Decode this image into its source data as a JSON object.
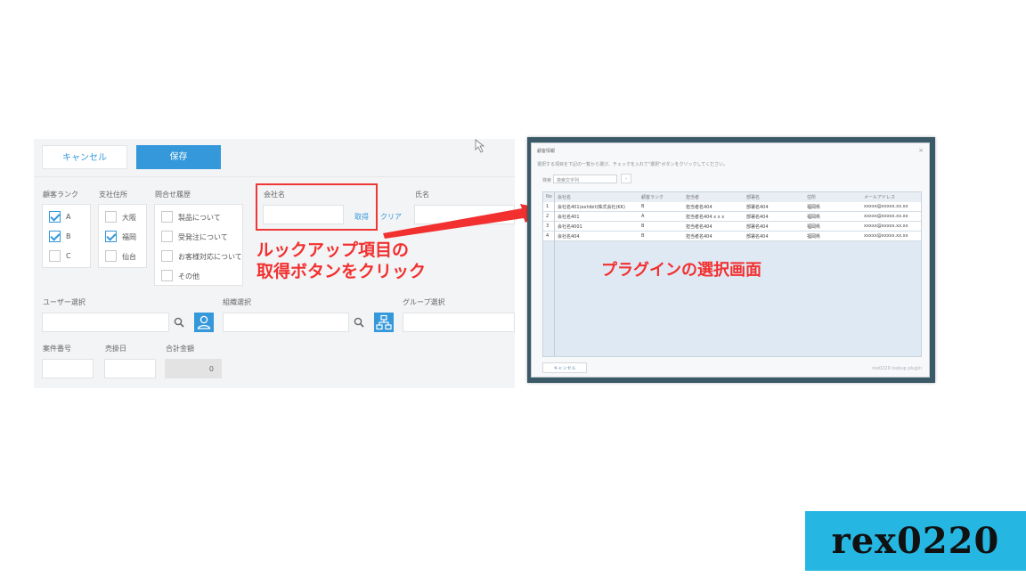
{
  "form": {
    "cancel_label": "キャンセル",
    "save_label": "保存",
    "rank": {
      "label": "顧客ランク",
      "options": [
        {
          "label": "A",
          "checked": true
        },
        {
          "label": "B",
          "checked": true
        },
        {
          "label": "C",
          "checked": false
        }
      ]
    },
    "branch": {
      "label": "支社住所",
      "options": [
        {
          "label": "大阪",
          "checked": false
        },
        {
          "label": "福岡",
          "checked": true
        },
        {
          "label": "仙台",
          "checked": false
        }
      ]
    },
    "inquiry": {
      "label": "問合せ履歴",
      "options": [
        {
          "label": "製品について",
          "checked": false
        },
        {
          "label": "受発注について",
          "checked": false
        },
        {
          "label": "お客様対応について",
          "checked": false
        },
        {
          "label": "その他",
          "checked": false
        }
      ]
    },
    "company": {
      "label": "会社名",
      "value": "",
      "fetch_label": "取得",
      "clear_label": "クリア"
    },
    "company_extra_label": "氏名",
    "user_select_label": "ユーザー選択",
    "org_select_label": "組織選択",
    "group_select_label": "グループ選択",
    "case_no_label": "案件番号",
    "sale_date_label": "売掛日",
    "total_label": "合計金額",
    "total_value": "0"
  },
  "annotations": {
    "left_line1": "ルックアップ項目の",
    "left_line2": "取得ボタンをクリック",
    "right": "プラグインの選択画面",
    "color": "#f23030"
  },
  "dialog": {
    "title": "顧客情報",
    "hint": "選択する項目を下記の一覧から選び、チェックを入れて\"選択\"ボタンをクリックしてください。",
    "search_label": "検索",
    "search_value": "検索文字列",
    "columns": [
      "No",
      "会社名",
      "顧客ランク",
      "担当者",
      "部署名",
      "住所",
      "メールアドレス"
    ],
    "rows": [
      [
        "1",
        "会社名401(exhibit)株式会社(KK)",
        "B",
        "担当者名404",
        "部署名404",
        "福岡県",
        "xxxxx@xxxxx.xx.xx"
      ],
      [
        "2",
        "会社名401",
        "A",
        "担当者名404 x x x",
        "部署名404",
        "福岡県",
        "xxxxx@xxxxx.xx.xx"
      ],
      [
        "3",
        "会社名4001",
        "B",
        "担当者名404",
        "部署名404",
        "福岡県",
        "xxxxx@xxxxx.xx.xx"
      ],
      [
        "4",
        "会社名404",
        "B",
        "担当者名404",
        "部署名404",
        "福岡県",
        "xxxxx@xxxxx.xx.xx"
      ]
    ],
    "cancel_label": "キャンセル",
    "footer_credit": "rex0220 lookup plugin"
  },
  "logo": {
    "text": "rex0220"
  }
}
